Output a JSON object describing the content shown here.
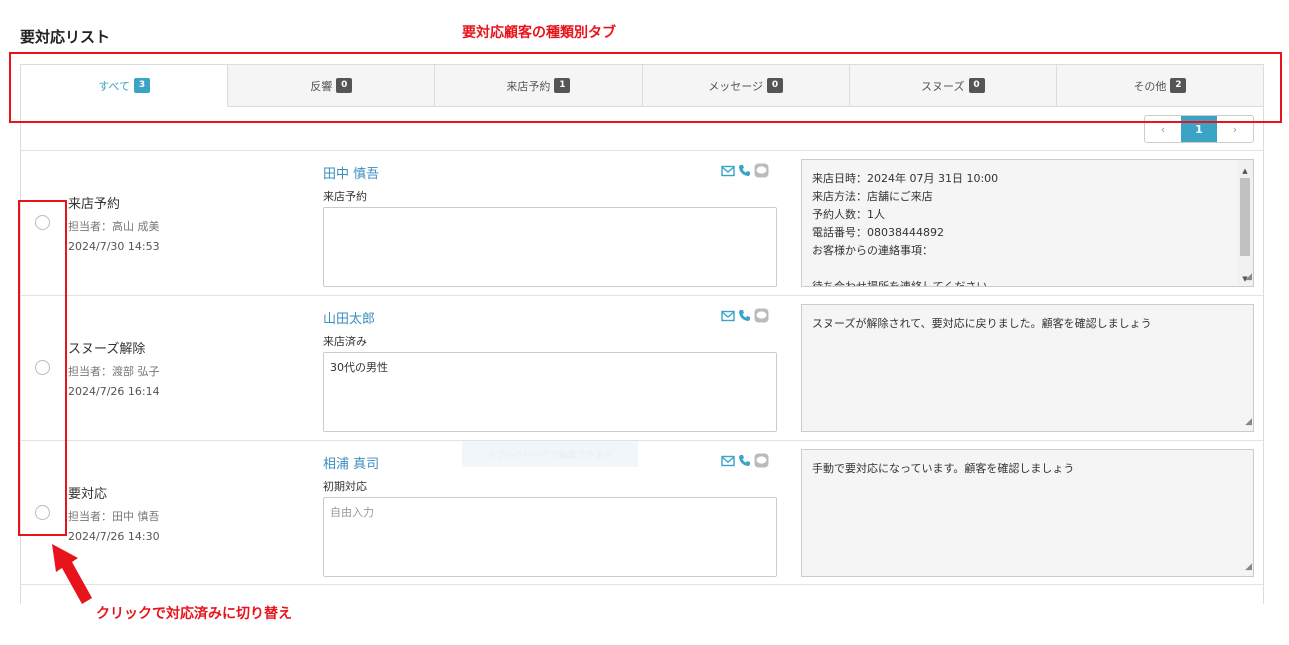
{
  "page_title": "要対応リスト",
  "annotations": {
    "tabs_note": "要対応顧客の種類別タブ",
    "click_note": "クリックで対応済みに切り替え"
  },
  "tabs": [
    {
      "label": "すべて",
      "count": "3",
      "active": true
    },
    {
      "label": "反響",
      "count": "0"
    },
    {
      "label": "来店予約",
      "count": "1"
    },
    {
      "label": "メッセージ",
      "count": "0"
    },
    {
      "label": "スヌーズ",
      "count": "0"
    },
    {
      "label": "その他",
      "count": "2"
    }
  ],
  "pagination": {
    "prev": "‹",
    "current": "1",
    "next": "›"
  },
  "rows": [
    {
      "status": "来店予約",
      "assignee": "担当者：高山 成美",
      "date": "2024/7/30 14:53",
      "customer_name": "田中 慎吾",
      "customer_type": "来店予約",
      "memo": "",
      "note_lines": [
        "来店日時：2024年 07月 31日 10:00",
        "来店方法：店舗にご来店",
        "予約人数：1人",
        "電話番号：08038444892",
        "お客様からの連絡事項：",
        "",
        "待ち合わせ場所を連絡してください"
      ]
    },
    {
      "status": "スヌーズ解除",
      "assignee": "担当者：渡部 弘子",
      "date": "2024/7/26 16:14",
      "customer_name": "山田太郎",
      "customer_type": "来店済み",
      "memo": "30代の男性",
      "note_lines": [
        "スヌーズが解除されて、要対応に戻りました。顧客を確認しましょう"
      ]
    },
    {
      "status": "要対応",
      "assignee": "担当者：田中 慎吾",
      "date": "2024/7/26 14:30",
      "customer_name": "相浦 真司",
      "customer_type": "初期対応",
      "memo_placeholder": "自由入力",
      "note_lines": [
        "手動で要対応になっています。顧客を確認しましょう"
      ]
    }
  ],
  "ghost_tooltip": "ダブルクリックで編集できます",
  "colors": {
    "accent": "#3aa3c6",
    "annotation_red": "#e8141b",
    "badge_dark": "#555555"
  },
  "icons": [
    "mail-icon",
    "phone-icon",
    "chat-icon"
  ]
}
